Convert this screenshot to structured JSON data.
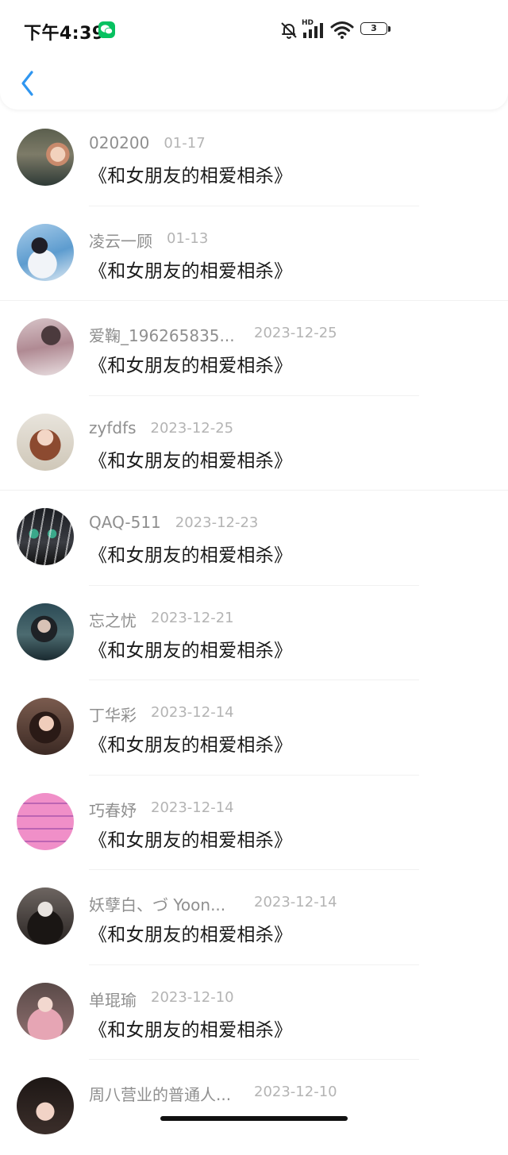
{
  "status_bar": {
    "time": "下午4:39",
    "battery": "3",
    "network_label": "HD"
  },
  "header": {
    "back_icon": "chevron-left-icon",
    "accent_color": "#2f96f0"
  },
  "items": [
    {
      "name": "020200",
      "date": "01-17",
      "title": "《和女朋友的相爱相杀》"
    },
    {
      "name": "凌云一顾",
      "date": "01-13",
      "title": "《和女朋友的相爱相杀》"
    },
    {
      "name": "爱鞠_196265835...",
      "date": "2023-12-25",
      "title": "《和女朋友的相爱相杀》"
    },
    {
      "name": "zyfdfs",
      "date": "2023-12-25",
      "title": "《和女朋友的相爱相杀》"
    },
    {
      "name": "QAQ-511",
      "date": "2023-12-23",
      "title": "《和女朋友的相爱相杀》"
    },
    {
      "name": "忘之忧",
      "date": "2023-12-21",
      "title": "《和女朋友的相爱相杀》"
    },
    {
      "name": "丁华彩",
      "date": "2023-12-14",
      "title": "《和女朋友的相爱相杀》"
    },
    {
      "name": "巧春妤",
      "date": "2023-12-14",
      "title": "《和女朋友的相爱相杀》"
    },
    {
      "name": "妖孽白、づ Yoon...",
      "date": "2023-12-14",
      "title": "《和女朋友的相爱相杀》"
    },
    {
      "name": "单琨瑜",
      "date": "2023-12-10",
      "title": "《和女朋友的相爱相杀》"
    },
    {
      "name": "周八营业的普通人...",
      "date": "2023-12-10",
      "title": ""
    }
  ]
}
